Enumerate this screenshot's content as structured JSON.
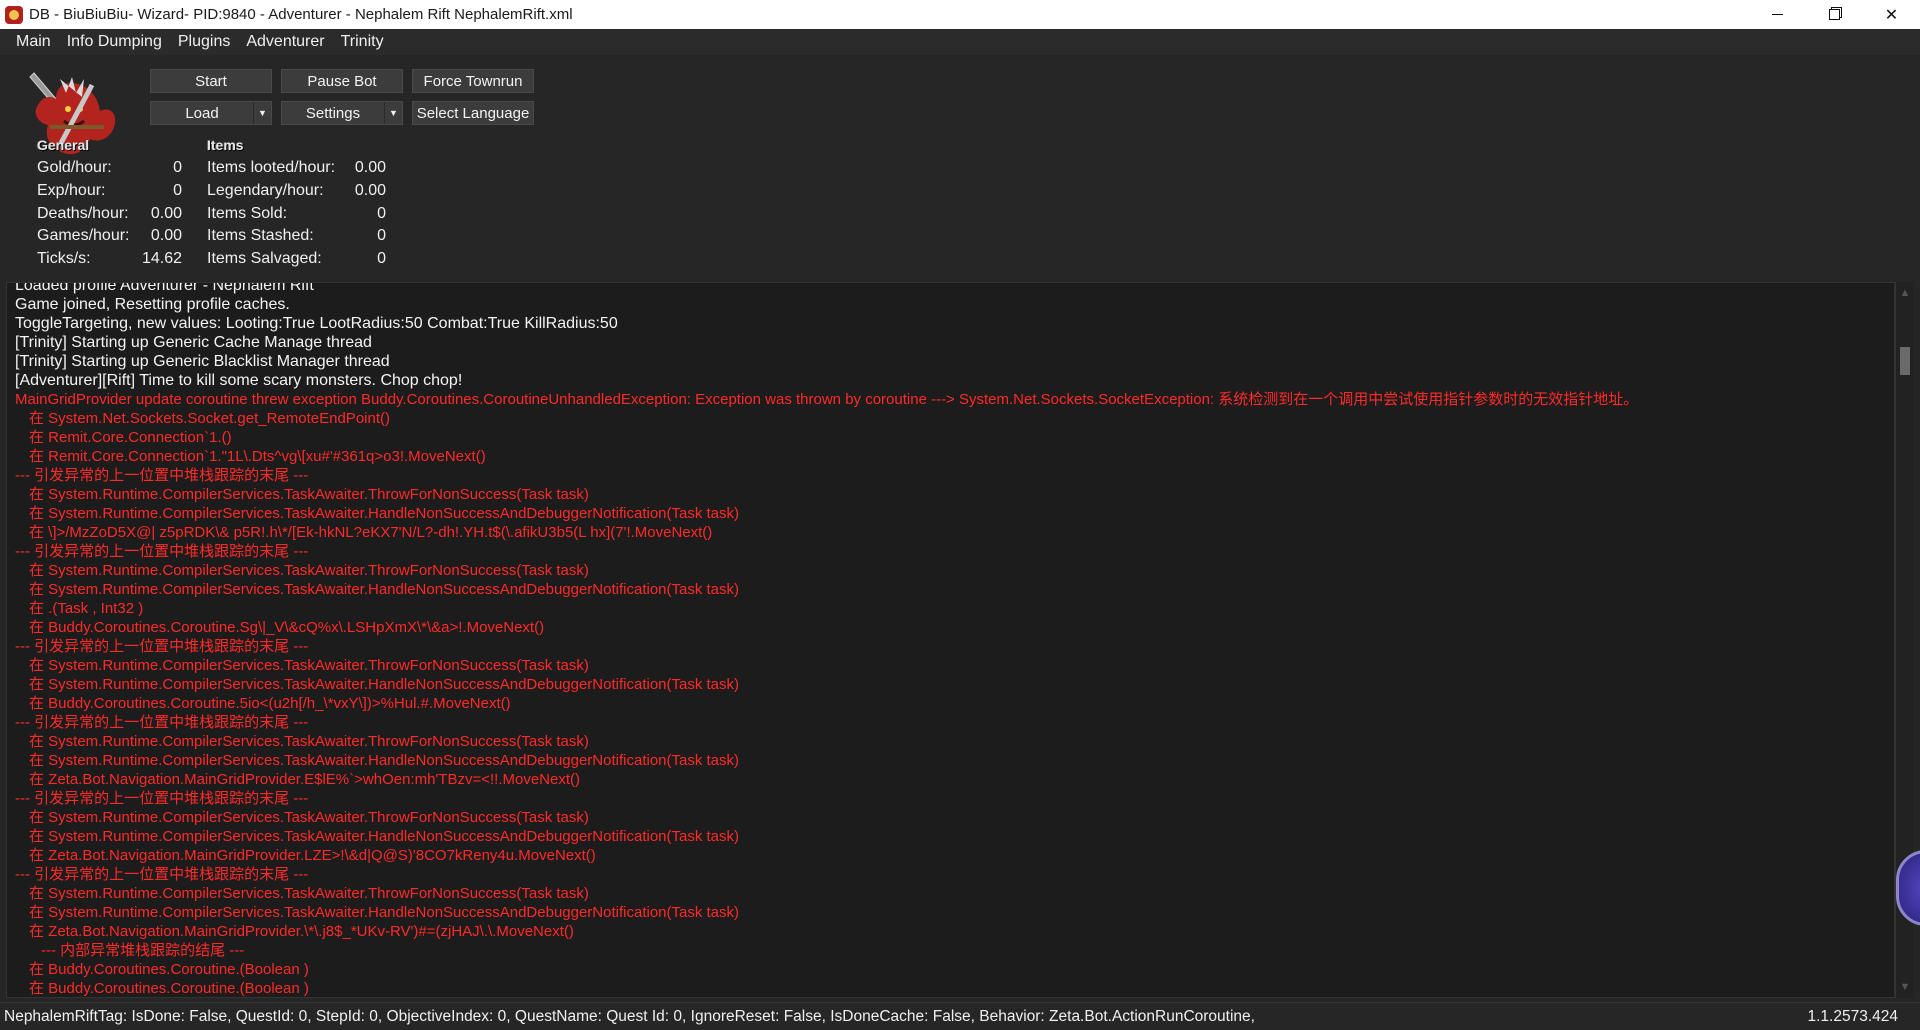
{
  "titlebar": {
    "title": "DB - BiuBiuBiu- Wizard- PID:9840 - Adventurer - Nephalem Rift NephalemRift.xml",
    "minimize": "",
    "restore": "",
    "close": "✕"
  },
  "menu": [
    "Main",
    "Info Dumping",
    "Plugins",
    "Adventurer",
    "Trinity"
  ],
  "buttons": {
    "start": "Start",
    "pause_bot": "Pause Bot",
    "force_townrun": "Force Townrun",
    "load": "Load",
    "settings": "Settings",
    "select_language": "Select Language",
    "dropdown_arrow": "▼"
  },
  "stats": {
    "general_heading": "General",
    "items_heading": "Items",
    "general": [
      {
        "label": "Gold/hour:",
        "value": "0"
      },
      {
        "label": "Exp/hour:",
        "value": "0"
      },
      {
        "label": "Deaths/hour:",
        "value": "0.00"
      },
      {
        "label": "Games/hour:",
        "value": "0.00"
      },
      {
        "label": "Ticks/s:",
        "value": "14.62"
      }
    ],
    "items": [
      {
        "label": "Items looted/hour:",
        "value": "0.00"
      },
      {
        "label": "Legendary/hour:",
        "value": "0.00"
      },
      {
        "label": "Items Sold:",
        "value": "0"
      },
      {
        "label": "Items Stashed:",
        "value": "0"
      },
      {
        "label": "Items Salvaged:",
        "value": "0"
      }
    ]
  },
  "log": [
    {
      "text": "Loaded profile Adventurer - Nephalem Rift",
      "color": "white",
      "indent": 0
    },
    {
      "text": "Game joined, Resetting profile caches.",
      "color": "white",
      "indent": 0
    },
    {
      "text": "ToggleTargeting, new values: Looting:True LootRadius:50 Combat:True KillRadius:50",
      "color": "white",
      "indent": 0
    },
    {
      "text": "[Trinity] Starting up Generic Cache Manage thread",
      "color": "white",
      "indent": 0
    },
    {
      "text": "[Trinity] Starting up Generic Blacklist Manager thread",
      "color": "white",
      "indent": 0
    },
    {
      "text": "[Adventurer][Rift] Time to kill some scary monsters. Chop chop!",
      "color": "white",
      "indent": 0
    },
    {
      "text": "MainGridProvider update coroutine threw exception Buddy.Coroutines.CoroutineUnhandledException: Exception was thrown by coroutine ---> System.Net.Sockets.SocketException: 系统检测到在一个调用中尝试使用指针参数时的无效指针地址。",
      "color": "red",
      "indent": 0
    },
    {
      "text": "在 System.Net.Sockets.Socket.get_RemoteEndPoint()",
      "color": "red",
      "indent": 1
    },
    {
      "text": "在 Remit.Core.Connection`1.()",
      "color": "red",
      "indent": 1
    },
    {
      "text": "在 Remit.Core.Connection`1.\"1L\\.Dts^vg\\[xu#'#361q>o3!.MoveNext()",
      "color": "red",
      "indent": 1
    },
    {
      "text": "--- 引发异常的上一位置中堆栈跟踪的末尾 ---",
      "color": "red",
      "indent": 0
    },
    {
      "text": "在 System.Runtime.CompilerServices.TaskAwaiter.ThrowForNonSuccess(Task task)",
      "color": "red",
      "indent": 1
    },
    {
      "text": "在 System.Runtime.CompilerServices.TaskAwaiter.HandleNonSuccessAndDebuggerNotification(Task task)",
      "color": "red",
      "indent": 1
    },
    {
      "text": "在 \\]>/MzZoD5X@| z5pRDK\\& p5R!.h\\*/[Ek-hkNL?eKX7'N/L?-dh!.YH.t$(\\.afikU3b5(L hx](7'!.MoveNext()",
      "color": "red",
      "indent": 1
    },
    {
      "text": "--- 引发异常的上一位置中堆栈跟踪的末尾 ---",
      "color": "red",
      "indent": 0
    },
    {
      "text": "在 System.Runtime.CompilerServices.TaskAwaiter.ThrowForNonSuccess(Task task)",
      "color": "red",
      "indent": 1
    },
    {
      "text": "在 System.Runtime.CompilerServices.TaskAwaiter.HandleNonSuccessAndDebuggerNotification(Task task)",
      "color": "red",
      "indent": 1
    },
    {
      "text": "在 .(Task , Int32 )",
      "color": "red",
      "indent": 1
    },
    {
      "text": "在 Buddy.Coroutines.Coroutine.Sg\\|_V\\&cQ%x\\.LSHpXmX\\*\\&a>!.MoveNext()",
      "color": "red",
      "indent": 1
    },
    {
      "text": "--- 引发异常的上一位置中堆栈跟踪的末尾 ---",
      "color": "red",
      "indent": 0
    },
    {
      "text": "在 System.Runtime.CompilerServices.TaskAwaiter.ThrowForNonSuccess(Task task)",
      "color": "red",
      "indent": 1
    },
    {
      "text": "在 System.Runtime.CompilerServices.TaskAwaiter.HandleNonSuccessAndDebuggerNotification(Task task)",
      "color": "red",
      "indent": 1
    },
    {
      "text": "在 Buddy.Coroutines.Coroutine.5io<(u2h[/h_\\*vxY\\])>%Hul.#.MoveNext()",
      "color": "red",
      "indent": 1
    },
    {
      "text": "--- 引发异常的上一位置中堆栈跟踪的末尾 ---",
      "color": "red",
      "indent": 0
    },
    {
      "text": "在 System.Runtime.CompilerServices.TaskAwaiter.ThrowForNonSuccess(Task task)",
      "color": "red",
      "indent": 1
    },
    {
      "text": "在 System.Runtime.CompilerServices.TaskAwaiter.HandleNonSuccessAndDebuggerNotification(Task task)",
      "color": "red",
      "indent": 1
    },
    {
      "text": "在 Zeta.Bot.Navigation.MainGridProvider.E$lE%`>whOen:mh'TBzv=<!!.MoveNext()",
      "color": "red",
      "indent": 1
    },
    {
      "text": "--- 引发异常的上一位置中堆栈跟踪的末尾 ---",
      "color": "red",
      "indent": 0
    },
    {
      "text": "在 System.Runtime.CompilerServices.TaskAwaiter.ThrowForNonSuccess(Task task)",
      "color": "red",
      "indent": 1
    },
    {
      "text": "在 System.Runtime.CompilerServices.TaskAwaiter.HandleNonSuccessAndDebuggerNotification(Task task)",
      "color": "red",
      "indent": 1
    },
    {
      "text": "在 Zeta.Bot.Navigation.MainGridProvider.LZE>!\\&d|Q@S)'8CO7kReny4u.MoveNext()",
      "color": "red",
      "indent": 1
    },
    {
      "text": "--- 引发异常的上一位置中堆栈跟踪的末尾 ---",
      "color": "red",
      "indent": 0
    },
    {
      "text": "在 System.Runtime.CompilerServices.TaskAwaiter.ThrowForNonSuccess(Task task)",
      "color": "red",
      "indent": 1
    },
    {
      "text": "在 System.Runtime.CompilerServices.TaskAwaiter.HandleNonSuccessAndDebuggerNotification(Task task)",
      "color": "red",
      "indent": 1
    },
    {
      "text": "在 Zeta.Bot.Navigation.MainGridProvider.\\*\\.j8$_*UKv-RV')#=(zjHAJ\\.\\.MoveNext()",
      "color": "red",
      "indent": 1
    },
    {
      "text": "--- 内部异常堆栈跟踪的结尾 ---",
      "color": "red",
      "indent": 2
    },
    {
      "text": "在 Buddy.Coroutines.Coroutine.(Boolean )",
      "color": "red",
      "indent": 1
    },
    {
      "text": "在 Buddy.Coroutines.Coroutine.(Boolean )",
      "color": "red",
      "indent": 1
    }
  ],
  "statusbar": {
    "text": "NephalemRiftTag: IsDone: False, QuestId: 0, StepId: 0, ObjectiveIndex: 0, QuestName: Quest Id: 0, IgnoreReset: False, IsDoneCache: False, Behavior: Zeta.Bot.ActionRunCoroutine,",
    "version": "1.1.2573.424"
  },
  "scrollbar": {
    "up": "▲",
    "down": "▼"
  },
  "colors": {
    "log_error": "#ff2a2a",
    "log_info": "#f4f4f4",
    "background": "#262626"
  }
}
